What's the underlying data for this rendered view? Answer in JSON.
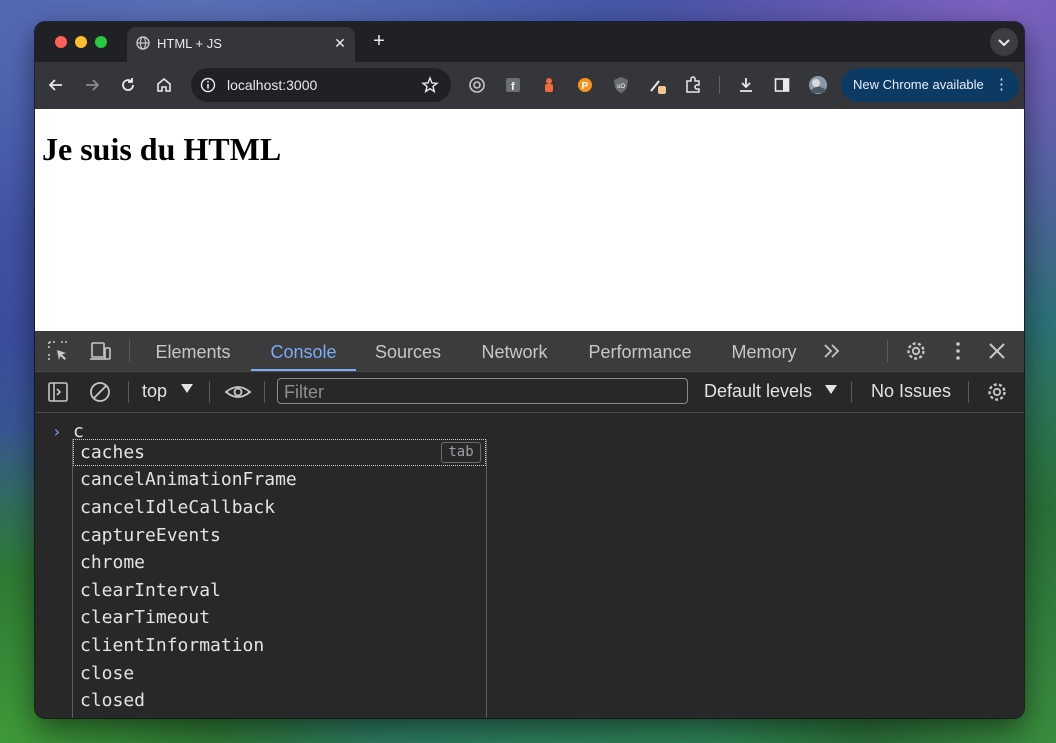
{
  "browser": {
    "tab_title": "HTML + JS",
    "url": "localhost:3000",
    "update_label": "New Chrome available"
  },
  "page": {
    "heading": "Je suis du HTML"
  },
  "devtools": {
    "tabs": [
      "Elements",
      "Console",
      "Sources",
      "Network",
      "Performance",
      "Memory"
    ],
    "active_tab": "Console",
    "context": "top",
    "filter_placeholder": "Filter",
    "levels": "Default levels",
    "issues": "No Issues",
    "console_input": "c",
    "autocomplete_hint": "tab",
    "suggestions": [
      "caches",
      "cancelAnimationFrame",
      "cancelIdleCallback",
      "captureEvents",
      "chrome",
      "clearInterval",
      "clearTimeout",
      "clientInformation",
      "close",
      "closed"
    ]
  },
  "colors": {
    "active_tab": "#7cacf8",
    "update_button": "#0b3a63"
  }
}
